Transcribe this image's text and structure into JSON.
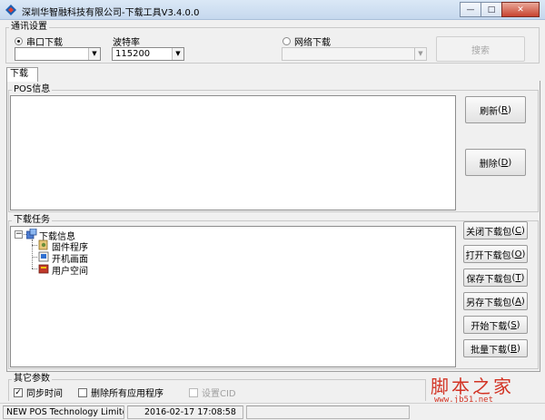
{
  "window": {
    "title": "深圳华智融科技有限公司-下载工具V3.4.0.0",
    "minimize_glyph": "—",
    "maximize_glyph": "□",
    "close_glyph": "✕",
    "icon": "app-logo-icon"
  },
  "comm": {
    "title": "通讯设置",
    "serial_label": "串口下载",
    "serial_selected": true,
    "port_value": "",
    "baud_label": "波特率",
    "baud_value": "115200",
    "network_label": "网络下载",
    "network_selected": false,
    "network_value": "",
    "search_button": "搜索"
  },
  "tabs": [
    {
      "label": "下载",
      "active": true
    }
  ],
  "pos_info": {
    "title": "POS信息",
    "refresh_button": "刷新",
    "refresh_key": "R",
    "delete_button": "删除",
    "delete_key": "D"
  },
  "tasks": {
    "title": "下载任务",
    "root": {
      "label": "下载信息",
      "toggle": "−"
    },
    "children": [
      {
        "label": "固件程序",
        "icon": "firmware-icon"
      },
      {
        "label": "开机画面",
        "icon": "boot-screen-icon"
      },
      {
        "label": "用户空间",
        "icon": "user-space-icon"
      }
    ],
    "buttons": [
      {
        "label": "关闭下载包",
        "key": "C"
      },
      {
        "label": "打开下载包",
        "key": "O"
      },
      {
        "label": "保存下载包",
        "key": "T"
      },
      {
        "label": "另存下载包",
        "key": "A"
      },
      {
        "label": "开始下载",
        "key": "S"
      },
      {
        "label": "批量下载",
        "key": "B"
      }
    ]
  },
  "other": {
    "title": "其它参数",
    "sync_time": "同步时间",
    "sync_time_checked": true,
    "delete_apps": "删除所有应用程序",
    "delete_apps_checked": false,
    "set_cid": "设置CID",
    "set_cid_checked": false
  },
  "status": {
    "company": "NEW POS Technology Limite",
    "datetime": "2016-02-17 17:08:58"
  },
  "watermark": {
    "main": "脚本之家",
    "sub": "www.jb51.net"
  },
  "colors": {
    "watermark": "#d23324",
    "titlebar": "#c6d8ee"
  }
}
